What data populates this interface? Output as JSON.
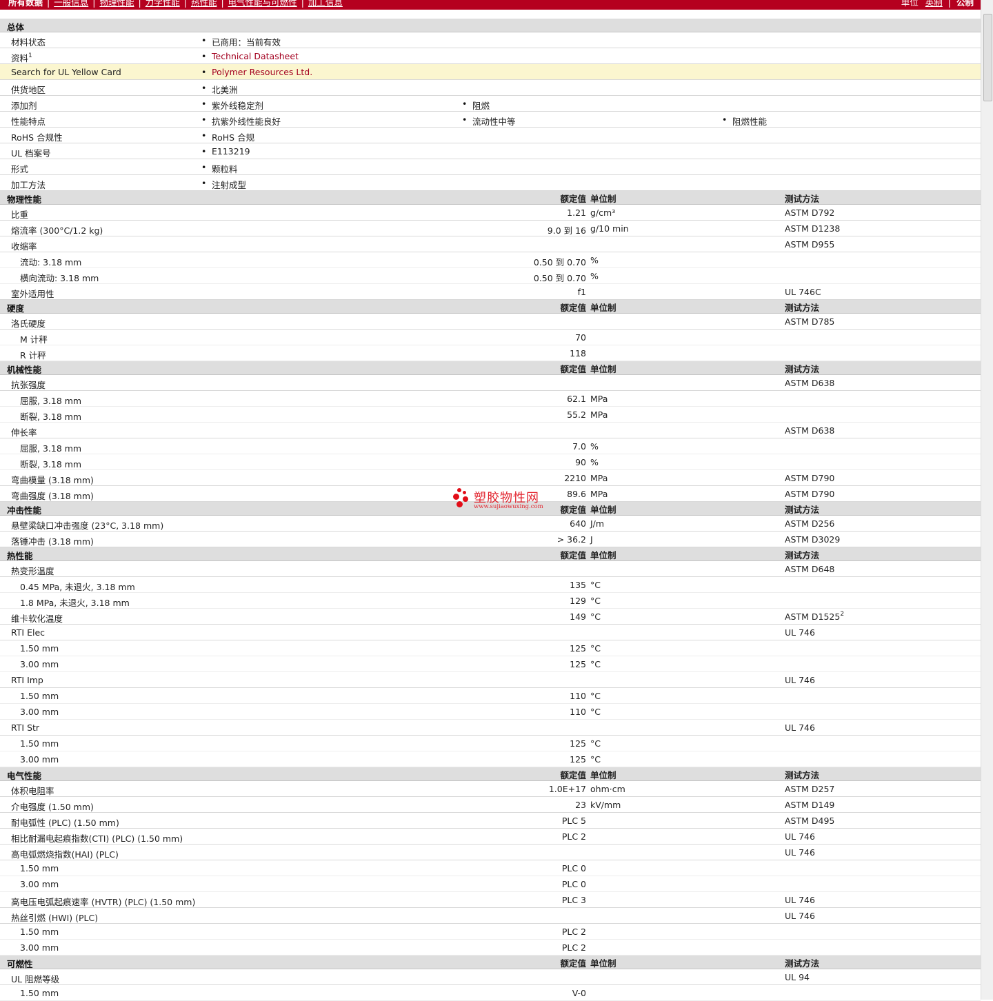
{
  "topnav": {
    "items": [
      "所有数据",
      "一般信息",
      "物理性能",
      "力学性能",
      "热性能",
      "电气性能与可燃性",
      "加工信息"
    ],
    "right": {
      "label": "单位",
      "imperial": "英制",
      "metric": "公制"
    }
  },
  "columns": {
    "nominal": "额定值",
    "unit": "单位制",
    "test": "测试方法"
  },
  "general": {
    "title": "总体",
    "rows": [
      {
        "label": "材料状态",
        "values": [
          "已商用：当前有效"
        ]
      },
      {
        "label": "资料",
        "sup": "1",
        "values": [
          "Technical Datasheet"
        ],
        "link": true
      },
      {
        "label": "Search for UL Yellow Card",
        "values": [
          "Polymer Resources Ltd."
        ],
        "link": true,
        "highlight": true
      },
      {
        "label": "供货地区",
        "values": [
          "北美洲"
        ]
      },
      {
        "label": "添加剂",
        "values": [
          "紫外线稳定剂",
          "阻燃"
        ]
      },
      {
        "label": "性能特点",
        "values": [
          "抗紫外线性能良好",
          "流动性中等",
          "阻燃性能"
        ]
      },
      {
        "label": "RoHS 合规性",
        "values": [
          "RoHS 合规"
        ]
      },
      {
        "label": "UL 档案号",
        "values": [
          "E113219"
        ]
      },
      {
        "label": "形式",
        "values": [
          "颗粒料"
        ]
      },
      {
        "label": "加工方法",
        "values": [
          "注射成型"
        ]
      }
    ]
  },
  "sections": [
    {
      "title": "物理性能",
      "rows": [
        {
          "label": "比重",
          "value": "1.21",
          "unit": "g/cm³",
          "test": "ASTM D792"
        },
        {
          "label": "熔流率  (300°C/1.2 kg)",
          "value": "9.0 到  16",
          "unit": "g/10 min",
          "test": "ASTM D1238"
        },
        {
          "label": "收缩率",
          "value": "",
          "unit": "",
          "test": "ASTM D955"
        },
        {
          "label": "流动: 3.18 mm",
          "value": "0.50 到  0.70",
          "unit": "%",
          "test": "",
          "sub": true
        },
        {
          "label": "横向流动: 3.18 mm",
          "value": "0.50 到  0.70",
          "unit": "%",
          "test": "",
          "sub": true
        },
        {
          "label": "室外适用性",
          "value": "f1",
          "unit": "",
          "test": "UL 746C"
        }
      ]
    },
    {
      "title": "硬度",
      "rows": [
        {
          "label": "洛氏硬度",
          "value": "",
          "unit": "",
          "test": "ASTM D785"
        },
        {
          "label": "M 计秤",
          "value": "70",
          "unit": "",
          "test": "",
          "sub": true
        },
        {
          "label": "R 计秤",
          "value": "118",
          "unit": "",
          "test": "",
          "sub": true
        }
      ]
    },
    {
      "title": "机械性能",
      "rows": [
        {
          "label": "抗张强度",
          "value": "",
          "unit": "",
          "test": "ASTM D638"
        },
        {
          "label": "屈服, 3.18 mm",
          "value": "62.1",
          "unit": "MPa",
          "test": "",
          "sub": true
        },
        {
          "label": "断裂, 3.18 mm",
          "value": "55.2",
          "unit": "MPa",
          "test": "",
          "sub": true
        },
        {
          "label": "伸长率",
          "value": "",
          "unit": "",
          "test": "ASTM D638"
        },
        {
          "label": "屈服, 3.18 mm",
          "value": "7.0",
          "unit": "%",
          "test": "",
          "sub": true
        },
        {
          "label": "断裂, 3.18 mm",
          "value": "90",
          "unit": "%",
          "test": "",
          "sub": true
        },
        {
          "label": "弯曲模量  (3.18 mm)",
          "value": "2210",
          "unit": "MPa",
          "test": "ASTM D790"
        },
        {
          "label": "弯曲强度  (3.18 mm)",
          "value": "89.6",
          "unit": "MPa",
          "test": "ASTM D790"
        }
      ]
    },
    {
      "title": "冲击性能",
      "rows": [
        {
          "label": "悬壁梁缺口冲击强度  (23°C, 3.18 mm)",
          "value": "640",
          "unit": "J/m",
          "test": "ASTM D256"
        },
        {
          "label": "落锤冲击  (3.18 mm)",
          "value": "> 36.2",
          "unit": "J",
          "test": "ASTM D3029"
        }
      ]
    },
    {
      "title": "热性能",
      "rows": [
        {
          "label": "热变形温度",
          "value": "",
          "unit": "",
          "test": "ASTM D648"
        },
        {
          "label": "0.45 MPa, 未退火, 3.18 mm",
          "value": "135",
          "unit": "°C",
          "test": "",
          "sub": true
        },
        {
          "label": "1.8 MPa, 未退火, 3.18 mm",
          "value": "129",
          "unit": "°C",
          "test": "",
          "sub": true
        },
        {
          "label": "维卡软化温度",
          "value": "149",
          "unit": "°C",
          "test": "ASTM D1525",
          "testSup": "2"
        },
        {
          "label": "RTI Elec",
          "value": "",
          "unit": "",
          "test": "UL 746"
        },
        {
          "label": "1.50 mm",
          "value": "125",
          "unit": "°C",
          "test": "",
          "sub": true
        },
        {
          "label": "3.00 mm",
          "value": "125",
          "unit": "°C",
          "test": "",
          "sub": true
        },
        {
          "label": "RTI Imp",
          "value": "",
          "unit": "",
          "test": "UL 746"
        },
        {
          "label": "1.50 mm",
          "value": "110",
          "unit": "°C",
          "test": "",
          "sub": true
        },
        {
          "label": "3.00 mm",
          "value": "110",
          "unit": "°C",
          "test": "",
          "sub": true
        },
        {
          "label": "RTI Str",
          "value": "",
          "unit": "",
          "test": "UL 746"
        },
        {
          "label": "1.50 mm",
          "value": "125",
          "unit": "°C",
          "test": "",
          "sub": true
        },
        {
          "label": "3.00 mm",
          "value": "125",
          "unit": "°C",
          "test": "",
          "sub": true
        }
      ]
    },
    {
      "title": "电气性能",
      "rows": [
        {
          "label": "体积电阻率",
          "value": "1.0E+17",
          "unit": "ohm·cm",
          "test": "ASTM D257"
        },
        {
          "label": "介电强度  (1.50 mm)",
          "value": "23",
          "unit": "kV/mm",
          "test": "ASTM D149"
        },
        {
          "label": "耐电弧性  (PLC) (1.50 mm)",
          "value": "PLC 5",
          "unit": "",
          "test": "ASTM D495"
        },
        {
          "label": "相比耐漏电起痕指数(CTI) (PLC) (1.50 mm)",
          "value": "PLC 2",
          "unit": "",
          "test": "UL 746"
        },
        {
          "label": "高电弧燃烧指数(HAI) (PLC)",
          "value": "",
          "unit": "",
          "test": "UL 746"
        },
        {
          "label": "1.50 mm",
          "value": "PLC 0",
          "unit": "",
          "test": "",
          "sub": true
        },
        {
          "label": "3.00 mm",
          "value": "PLC 0",
          "unit": "",
          "test": "",
          "sub": true
        },
        {
          "label": "高电压电弧起痕速率  (HVTR) (PLC) (1.50 mm)",
          "value": "PLC 3",
          "unit": "",
          "test": "UL 746"
        },
        {
          "label": "热丝引燃  (HWI) (PLC)",
          "value": "",
          "unit": "",
          "test": "UL 746"
        },
        {
          "label": "1.50 mm",
          "value": "PLC 2",
          "unit": "",
          "test": "",
          "sub": true
        },
        {
          "label": "3.00 mm",
          "value": "PLC 2",
          "unit": "",
          "test": "",
          "sub": true
        }
      ]
    },
    {
      "title": "可燃性",
      "rows": [
        {
          "label": "UL 阻燃等级",
          "value": "",
          "unit": "",
          "test": "UL 94"
        },
        {
          "label": "1.50 mm",
          "value": "V-0",
          "unit": "",
          "test": "",
          "sub": true
        }
      ]
    }
  ],
  "watermark": {
    "text": "塑胶物性网",
    "url": "www.sujiaowuxing.com"
  }
}
